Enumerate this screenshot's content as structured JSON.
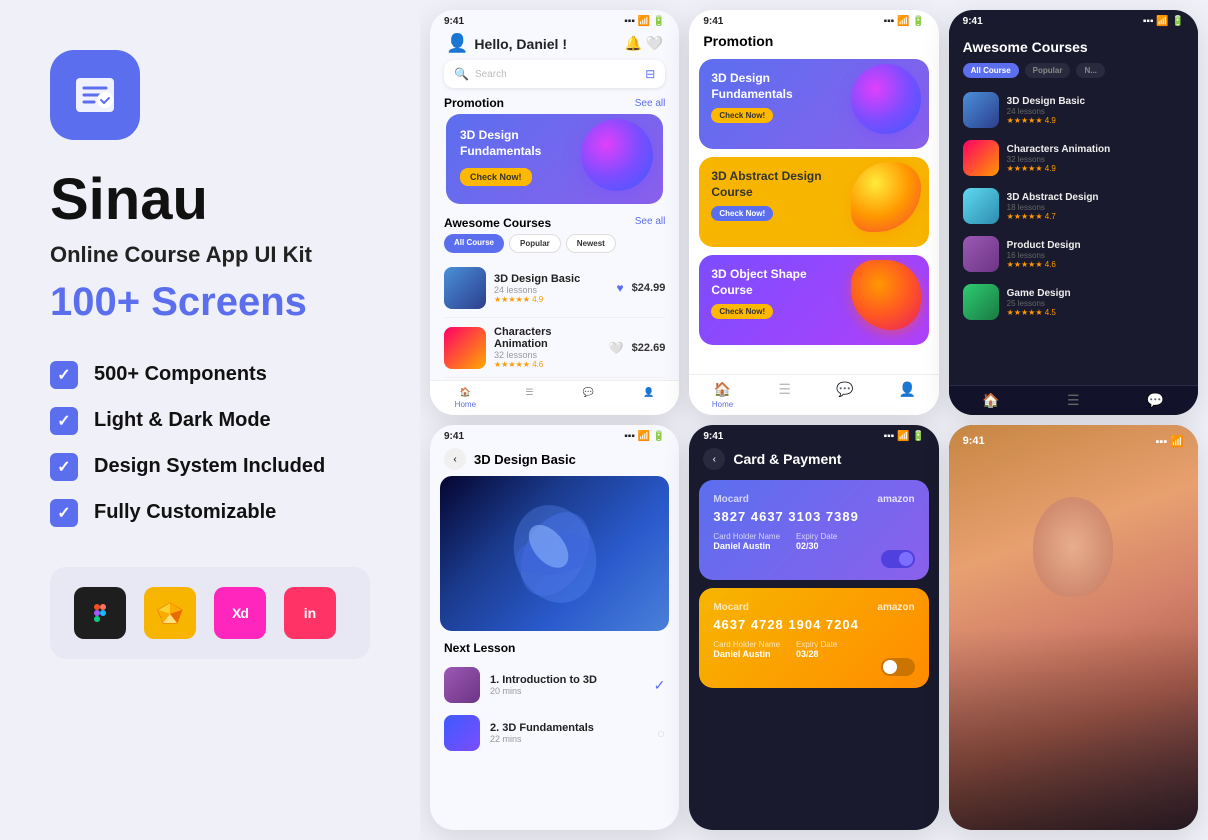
{
  "brand": {
    "logo_label": "Sinau",
    "tagline": "Online Course App UI Kit",
    "screens": "100+ Screens"
  },
  "features": [
    {
      "id": "components",
      "text": "500+ Components"
    },
    {
      "id": "lightdark",
      "text": "Light & Dark Mode"
    },
    {
      "id": "design-system",
      "text": "Design System Included"
    },
    {
      "id": "customizable",
      "text": "Fully Customizable"
    }
  ],
  "tools": [
    {
      "id": "figma",
      "label": "F"
    },
    {
      "id": "sketch",
      "label": "S"
    },
    {
      "id": "xd",
      "label": "Xd"
    },
    {
      "id": "invision",
      "label": "in"
    }
  ],
  "phone1": {
    "greeting": "Hello, Daniel !",
    "search_placeholder": "Search",
    "promotion_label": "Promotion",
    "see_all": "See all",
    "promo_course": "3D Design Fundamentals",
    "check_now": "Check Now!",
    "awesome_courses": "Awesome Courses",
    "filters": [
      "All Course",
      "Popular",
      "Newest"
    ],
    "courses": [
      {
        "name": "3D Design Basic",
        "lessons": "24 lessons",
        "rating": "4.9",
        "price": "$24.99"
      },
      {
        "name": "Characters Animation",
        "lessons": "32 lessons",
        "rating": "4.6",
        "price": "$22.69"
      }
    ],
    "nav_items": [
      "Home",
      "List",
      "Chat",
      "Profile"
    ]
  },
  "phone2": {
    "title": "Promotion",
    "cards": [
      {
        "name": "3D Design Fundamentals",
        "color": "blue",
        "btn": "Check Now!"
      },
      {
        "name": "3D Abstract Design Course",
        "color": "yellow",
        "btn": "Check Now!"
      },
      {
        "name": "3D Object Shape Course",
        "color": "purple",
        "btn": "Check Now!"
      }
    ],
    "nav_items": [
      "Home",
      "List",
      "Chat",
      "Profile"
    ]
  },
  "phone3": {
    "title": "Awesome Courses",
    "filters": [
      "All Course",
      "Popular",
      "N..."
    ],
    "courses": [
      {
        "name": "3D Design Basic",
        "lessons": "24 lessons",
        "rating": "4.9"
      },
      {
        "name": "Characters Animation",
        "lessons": "32 lessons",
        "rating": "4.9"
      },
      {
        "name": "3D Abstract Design",
        "lessons": "18 lessons",
        "rating": "4.7"
      },
      {
        "name": "Product Design",
        "lessons": "16 lessons",
        "rating": "4.6"
      },
      {
        "name": "Game Design",
        "lessons": "25 lessons",
        "rating": "4.5"
      }
    ],
    "nav_items": [
      "Home",
      "List",
      "Chat"
    ]
  },
  "phone4": {
    "status": "9:41",
    "back_label": "<",
    "course_title": "3D Design Basic",
    "next_lesson": "Next Lesson",
    "lessons": [
      {
        "name": "1. Introduction to 3D",
        "duration": "20 mins",
        "done": true
      },
      {
        "name": "2. 3D Fundamentals",
        "duration": "22 mins",
        "done": false
      }
    ]
  },
  "phone5": {
    "status": "9:41",
    "title": "Card & Payment",
    "cards": [
      {
        "brand": "Mocard",
        "partner": "amazon",
        "number": "3827 4637 3103 7389",
        "name": "Daniel Austin",
        "expiry": "02/30",
        "toggled": true
      },
      {
        "brand": "Mocard",
        "partner": "amazon",
        "number": "4637 4728 1904 7204",
        "name": "Daniel Austin",
        "expiry": "03/28",
        "toggled": false
      }
    ]
  },
  "phone6": {
    "status": "9:41"
  }
}
